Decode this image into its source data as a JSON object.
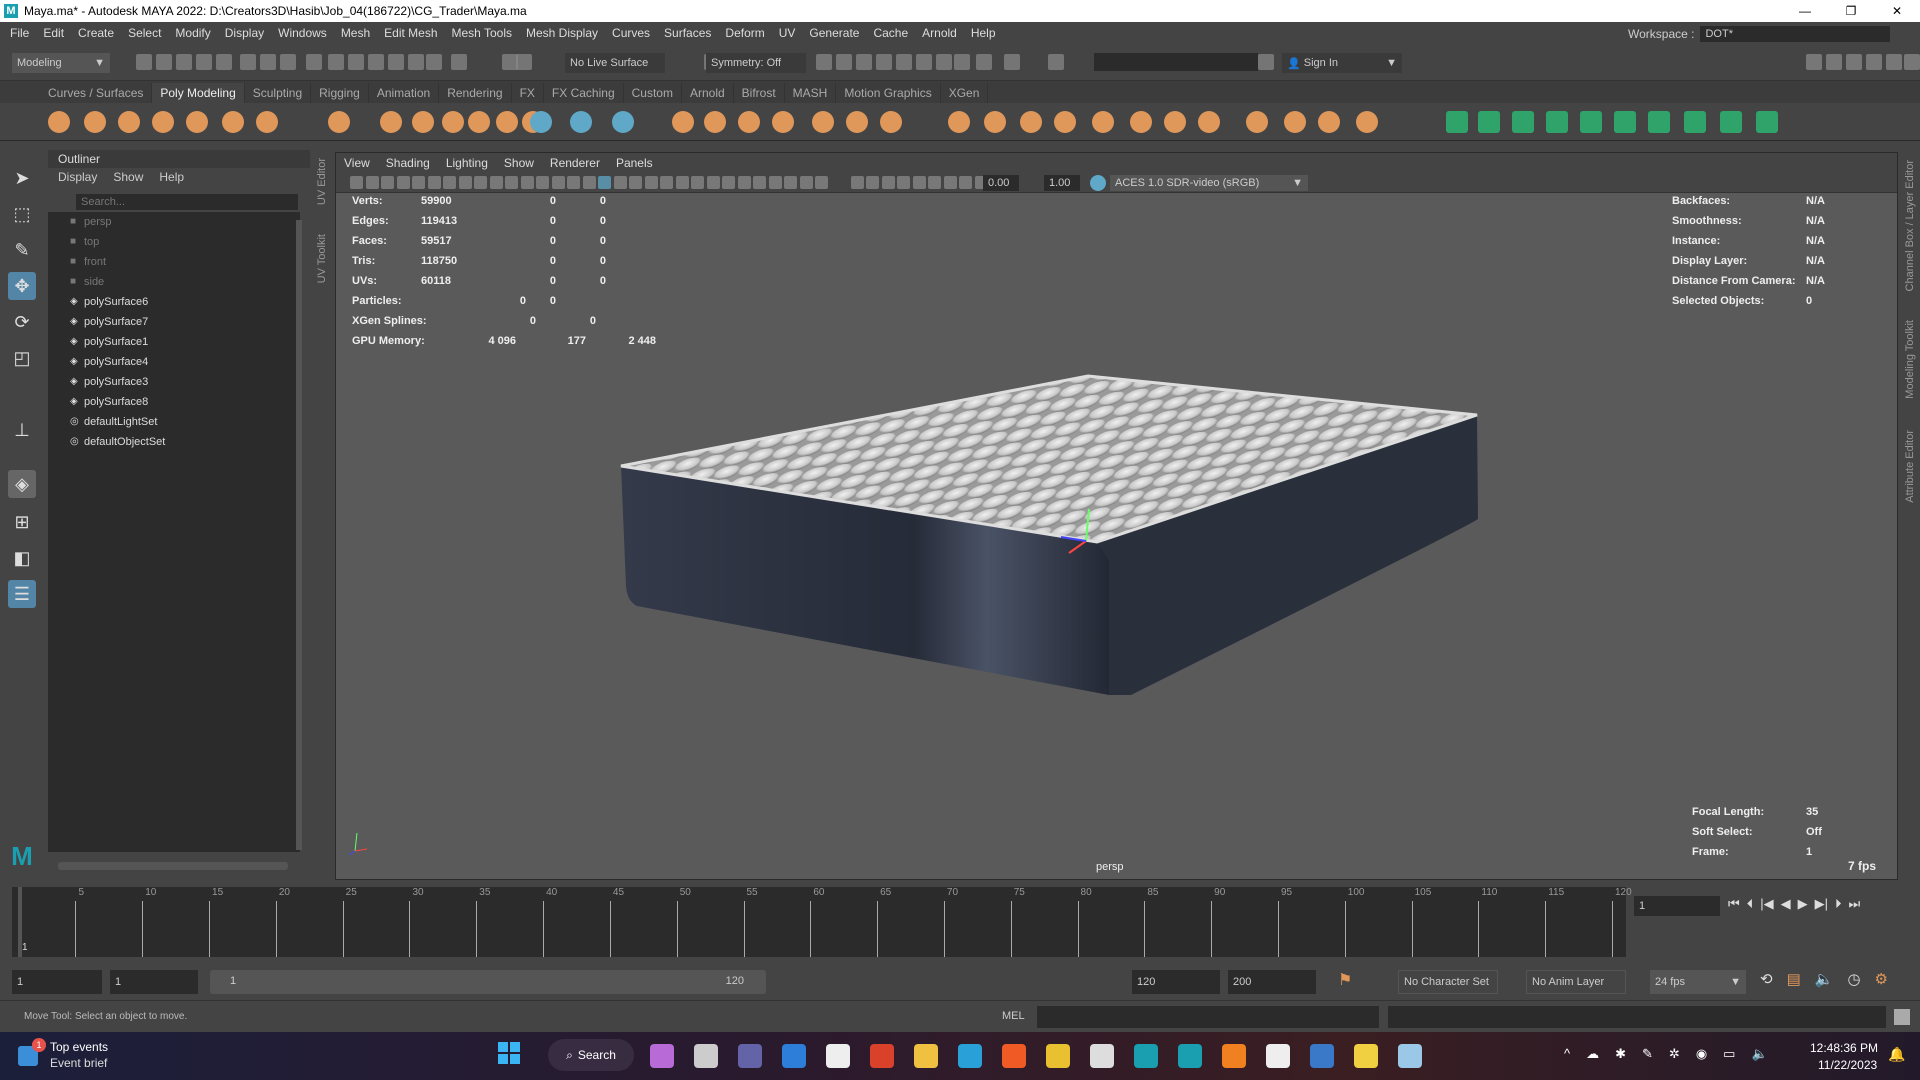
{
  "window": {
    "title": "Maya.ma* - Autodesk MAYA 2022: D:\\Creators3D\\Hasib\\Job_04(186722)\\CG_Trader\\Maya.ma",
    "logo": "M",
    "minimize": "—",
    "maximize": "❐",
    "close": "✕"
  },
  "menubar": [
    "File",
    "Edit",
    "Create",
    "Select",
    "Modify",
    "Display",
    "Windows",
    "Mesh",
    "Edit Mesh",
    "Mesh Tools",
    "Mesh Display",
    "Curves",
    "Surfaces",
    "Deform",
    "UV",
    "Generate",
    "Cache",
    "Arnold",
    "Help"
  ],
  "workspace": {
    "label": "Workspace :",
    "value": "DOT*"
  },
  "statusline": {
    "mode": "Modeling",
    "live_surface": "No Live Surface",
    "symmetry": "Symmetry: Off",
    "sign_in": "Sign In"
  },
  "shelf_tabs": [
    "Curves / Surfaces",
    "Poly Modeling",
    "Sculpting",
    "Rigging",
    "Animation",
    "Rendering",
    "FX",
    "FX Caching",
    "Custom",
    "Arnold",
    "Bifrost",
    "MASH",
    "Motion Graphics",
    "XGen"
  ],
  "active_shelf_tab": "Poly Modeling",
  "colors": {
    "accent": "#5fa8c8",
    "shelf_icon": "#e0975a",
    "active_tool": "#5285a6",
    "mattress_side": "#2c3140",
    "mattress_top": "#d6d6d6",
    "viewport": "#5a5a5a"
  },
  "outliner": {
    "title": "Outliner",
    "menu": [
      "Display",
      "Show",
      "Help"
    ],
    "search_placeholder": "Search...",
    "items": [
      {
        "label": "persp",
        "icon": "camera-icon",
        "dim": true
      },
      {
        "label": "top",
        "icon": "camera-icon",
        "dim": true
      },
      {
        "label": "front",
        "icon": "camera-icon",
        "dim": true
      },
      {
        "label": "side",
        "icon": "camera-icon",
        "dim": true
      },
      {
        "label": "polySurface6",
        "icon": "mesh-icon"
      },
      {
        "label": "polySurface7",
        "icon": "mesh-icon"
      },
      {
        "label": "polySurface1",
        "icon": "mesh-icon"
      },
      {
        "label": "polySurface4",
        "icon": "mesh-icon"
      },
      {
        "label": "polySurface3",
        "icon": "mesh-icon"
      },
      {
        "label": "polySurface8",
        "icon": "mesh-icon"
      },
      {
        "label": "defaultLightSet",
        "icon": "set-icon"
      },
      {
        "label": "defaultObjectSet",
        "icon": "set-icon"
      }
    ]
  },
  "left_vtabs": [
    "UV Editor",
    "UV Toolkit"
  ],
  "right_vtabs": [
    "Channel Box / Layer Editor",
    "Modeling Toolkit",
    "Attribute Editor"
  ],
  "viewport": {
    "menu": [
      "View",
      "Shading",
      "Lighting",
      "Show",
      "Renderer",
      "Panels"
    ],
    "exposure": "0.00",
    "gamma": "1.00",
    "color_space": "ACES 1.0 SDR-video (sRGB)",
    "camera": "persp",
    "fps": "7 fps",
    "stats": [
      {
        "label": "Verts:",
        "v": [
          "59900",
          "0",
          "0"
        ]
      },
      {
        "label": "Edges:",
        "v": [
          "119413",
          "0",
          "0"
        ]
      },
      {
        "label": "Faces:",
        "v": [
          "59517",
          "0",
          "0"
        ]
      },
      {
        "label": "Tris:",
        "v": [
          "118750",
          "0",
          "0"
        ]
      },
      {
        "label": "UVs:",
        "v": [
          "60118",
          "0",
          "0"
        ]
      },
      {
        "label": "Particles:",
        "v": [
          "0",
          "0"
        ]
      },
      {
        "label": "XGen Splines:",
        "v": [
          "0",
          "0"
        ]
      },
      {
        "label": "GPU Memory:",
        "v": [
          "4 096",
          "177",
          "2 448"
        ]
      }
    ],
    "info": [
      {
        "label": "Backfaces:",
        "v": "N/A"
      },
      {
        "label": "Smoothness:",
        "v": "N/A"
      },
      {
        "label": "Instance:",
        "v": "N/A"
      },
      {
        "label": "Display Layer:",
        "v": "N/A"
      },
      {
        "label": "Distance From Camera:",
        "v": "N/A"
      },
      {
        "label": "Selected Objects:",
        "v": "0"
      }
    ],
    "bottom_info": [
      {
        "label": "Focal Length:",
        "v": "35"
      },
      {
        "label": "Soft Select:",
        "v": "Off"
      },
      {
        "label": "Frame:",
        "v": "1"
      }
    ]
  },
  "timeline": {
    "ticks": [
      "5",
      "10",
      "15",
      "20",
      "25",
      "30",
      "35",
      "40",
      "45",
      "50",
      "55",
      "60",
      "65",
      "70",
      "75",
      "80",
      "85",
      "90",
      "95",
      "100",
      "105",
      "110",
      "115",
      "120"
    ],
    "start_label": "1",
    "current_frame": "1"
  },
  "range": {
    "start": "1",
    "playback_start": "1",
    "slider_start": "1",
    "slider_end": "120",
    "playback_end": "120",
    "end": "200",
    "character_set": "No Character Set",
    "anim_layer": "No Anim Layer",
    "fps": "24 fps"
  },
  "command": {
    "help": "Move Tool: Select an object to move.",
    "lang": "MEL"
  },
  "taskbar": {
    "widget_title": "Top events",
    "widget_sub": "Event brief",
    "badge": "1",
    "search": "Search",
    "time": "12:48:36 PM",
    "date": "11/22/2023"
  }
}
